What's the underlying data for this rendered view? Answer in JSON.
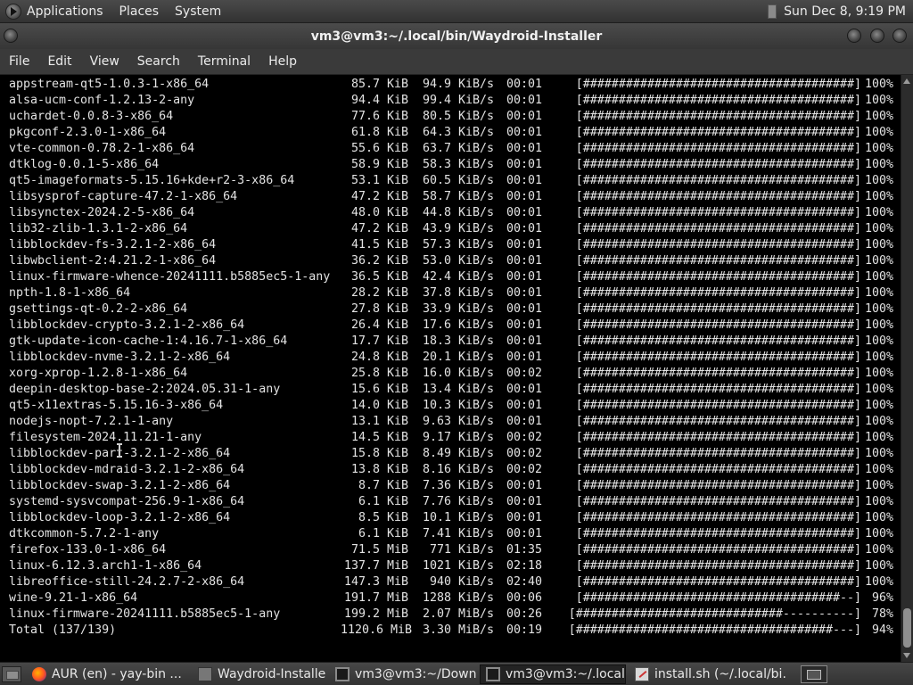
{
  "top_panel": {
    "applications": "Applications",
    "places": "Places",
    "system": "System",
    "clock": "Sun Dec  8,  9:19 PM"
  },
  "window": {
    "title": "vm3@vm3:~/.local/bin/Waydroid-Installer"
  },
  "menu": [
    "File",
    "Edit",
    "View",
    "Search",
    "Terminal",
    "Help"
  ],
  "terminal": {
    "lines": [
      {
        "name": "appstream-qt5-1.0.3-1-x86_64",
        "size": "85.7 KiB",
        "speed": "94.9 KiB/s",
        "time": "00:01",
        "bar": "[######################################]",
        "pct": "100%"
      },
      {
        "name": "alsa-ucm-conf-1.2.13-2-any",
        "size": "94.4 KiB",
        "speed": "99.4 KiB/s",
        "time": "00:01",
        "bar": "[######################################]",
        "pct": "100%"
      },
      {
        "name": "uchardet-0.0.8-3-x86_64",
        "size": "77.6 KiB",
        "speed": "80.5 KiB/s",
        "time": "00:01",
        "bar": "[######################################]",
        "pct": "100%"
      },
      {
        "name": "pkgconf-2.3.0-1-x86_64",
        "size": "61.8 KiB",
        "speed": "64.3 KiB/s",
        "time": "00:01",
        "bar": "[######################################]",
        "pct": "100%"
      },
      {
        "name": "vte-common-0.78.2-1-x86_64",
        "size": "55.6 KiB",
        "speed": "63.7 KiB/s",
        "time": "00:01",
        "bar": "[######################################]",
        "pct": "100%"
      },
      {
        "name": "dtklog-0.0.1-5-x86_64",
        "size": "58.9 KiB",
        "speed": "58.3 KiB/s",
        "time": "00:01",
        "bar": "[######################################]",
        "pct": "100%"
      },
      {
        "name": "qt5-imageformats-5.15.16+kde+r2-3-x86_64",
        "size": "53.1 KiB",
        "speed": "60.5 KiB/s",
        "time": "00:01",
        "bar": "[######################################]",
        "pct": "100%"
      },
      {
        "name": "libsysprof-capture-47.2-1-x86_64",
        "size": "47.2 KiB",
        "speed": "58.7 KiB/s",
        "time": "00:01",
        "bar": "[######################################]",
        "pct": "100%"
      },
      {
        "name": "libsynctex-2024.2-5-x86_64",
        "size": "48.0 KiB",
        "speed": "44.8 KiB/s",
        "time": "00:01",
        "bar": "[######################################]",
        "pct": "100%"
      },
      {
        "name": "lib32-zlib-1.3.1-2-x86_64",
        "size": "47.2 KiB",
        "speed": "43.9 KiB/s",
        "time": "00:01",
        "bar": "[######################################]",
        "pct": "100%"
      },
      {
        "name": "libblockdev-fs-3.2.1-2-x86_64",
        "size": "41.5 KiB",
        "speed": "57.3 KiB/s",
        "time": "00:01",
        "bar": "[######################################]",
        "pct": "100%"
      },
      {
        "name": "libwbclient-2:4.21.2-1-x86_64",
        "size": "36.2 KiB",
        "speed": "53.0 KiB/s",
        "time": "00:01",
        "bar": "[######################################]",
        "pct": "100%"
      },
      {
        "name": "linux-firmware-whence-20241111.b5885ec5-1-any",
        "size": "36.5 KiB",
        "speed": "42.4 KiB/s",
        "time": "00:01",
        "bar": "[######################################]",
        "pct": "100%"
      },
      {
        "name": "npth-1.8-1-x86_64",
        "size": "28.2 KiB",
        "speed": "37.8 KiB/s",
        "time": "00:01",
        "bar": "[######################################]",
        "pct": "100%"
      },
      {
        "name": "gsettings-qt-0.2-2-x86_64",
        "size": "27.8 KiB",
        "speed": "33.9 KiB/s",
        "time": "00:01",
        "bar": "[######################################]",
        "pct": "100%"
      },
      {
        "name": "libblockdev-crypto-3.2.1-2-x86_64",
        "size": "26.4 KiB",
        "speed": "17.6 KiB/s",
        "time": "00:01",
        "bar": "[######################################]",
        "pct": "100%"
      },
      {
        "name": "gtk-update-icon-cache-1:4.16.7-1-x86_64",
        "size": "17.7 KiB",
        "speed": "18.3 KiB/s",
        "time": "00:01",
        "bar": "[######################################]",
        "pct": "100%"
      },
      {
        "name": "libblockdev-nvme-3.2.1-2-x86_64",
        "size": "24.8 KiB",
        "speed": "20.1 KiB/s",
        "time": "00:01",
        "bar": "[######################################]",
        "pct": "100%"
      },
      {
        "name": "xorg-xprop-1.2.8-1-x86_64",
        "size": "25.8 KiB",
        "speed": "16.0 KiB/s",
        "time": "00:02",
        "bar": "[######################################]",
        "pct": "100%"
      },
      {
        "name": "deepin-desktop-base-2:2024.05.31-1-any",
        "size": "15.6 KiB",
        "speed": "13.4 KiB/s",
        "time": "00:01",
        "bar": "[######################################]",
        "pct": "100%"
      },
      {
        "name": "qt5-x11extras-5.15.16-3-x86_64",
        "size": "14.0 KiB",
        "speed": "10.3 KiB/s",
        "time": "00:01",
        "bar": "[######################################]",
        "pct": "100%"
      },
      {
        "name": "nodejs-nopt-7.2.1-1-any",
        "size": "13.1 KiB",
        "speed": "9.63 KiB/s",
        "time": "00:01",
        "bar": "[######################################]",
        "pct": "100%"
      },
      {
        "name": "filesystem-2024.11.21-1-any",
        "size": "14.5 KiB",
        "speed": "9.17 KiB/s",
        "time": "00:02",
        "bar": "[######################################]",
        "pct": "100%"
      },
      {
        "name": "libblockdev-part-3.2.1-2-x86_64",
        "size": "15.8 KiB",
        "speed": "8.49 KiB/s",
        "time": "00:02",
        "bar": "[######################################]",
        "pct": "100%"
      },
      {
        "name": "libblockdev-mdraid-3.2.1-2-x86_64",
        "size": "13.8 KiB",
        "speed": "8.16 KiB/s",
        "time": "00:02",
        "bar": "[######################################]",
        "pct": "100%"
      },
      {
        "name": "libblockdev-swap-3.2.1-2-x86_64",
        "size": "8.7 KiB",
        "speed": "7.36 KiB/s",
        "time": "00:01",
        "bar": "[######################################]",
        "pct": "100%"
      },
      {
        "name": "systemd-sysvcompat-256.9-1-x86_64",
        "size": "6.1 KiB",
        "speed": "7.76 KiB/s",
        "time": "00:01",
        "bar": "[######################################]",
        "pct": "100%"
      },
      {
        "name": "libblockdev-loop-3.2.1-2-x86_64",
        "size": "8.5 KiB",
        "speed": "10.1 KiB/s",
        "time": "00:01",
        "bar": "[######################################]",
        "pct": "100%"
      },
      {
        "name": "dtkcommon-5.7.2-1-any",
        "size": "6.1 KiB",
        "speed": "7.41 KiB/s",
        "time": "00:01",
        "bar": "[######################################]",
        "pct": "100%"
      },
      {
        "name": "firefox-133.0-1-x86_64",
        "size": "71.5 MiB",
        "speed": "771 KiB/s",
        "time": "01:35",
        "bar": "[######################################]",
        "pct": "100%"
      },
      {
        "name": "linux-6.12.3.arch1-1-x86_64",
        "size": "137.7 MiB",
        "speed": "1021 KiB/s",
        "time": "02:18",
        "bar": "[######################################]",
        "pct": "100%"
      },
      {
        "name": "libreoffice-still-24.2.7-2-x86_64",
        "size": "147.3 MiB",
        "speed": "940 KiB/s",
        "time": "02:40",
        "bar": "[######################################]",
        "pct": "100%"
      },
      {
        "name": "wine-9.21-1-x86_64",
        "size": "191.7 MiB",
        "speed": "1288 KiB/s",
        "time": "00:06",
        "bar": "[####################################--]",
        "pct": "96%"
      },
      {
        "name": "linux-firmware-20241111.b5885ec5-1-any",
        "size": "199.2 MiB",
        "speed": "2.07 MiB/s",
        "time": "00:26",
        "bar": "[#############################----------]",
        "pct": "78%"
      },
      {
        "name": "Total (137/139)",
        "size": "1120.6 MiB",
        "speed": "3.30 MiB/s",
        "time": "00:19",
        "bar": "[####################################---]",
        "pct": "94%"
      }
    ]
  },
  "taskbar": {
    "tasks": [
      {
        "label": "AUR (en) - yay-bin ...",
        "icon": "firefox-icon",
        "active": false
      },
      {
        "label": "Waydroid-Installer",
        "icon": "window-icon",
        "active": false
      },
      {
        "label": "vm3@vm3:~/Downl...",
        "icon": "terminal-icon",
        "active": false
      },
      {
        "label": "vm3@vm3:~/.local/...",
        "icon": "terminal-icon",
        "active": true
      },
      {
        "label": "install.sh (~/.local/bi...",
        "icon": "editor-icon",
        "active": false
      }
    ]
  }
}
